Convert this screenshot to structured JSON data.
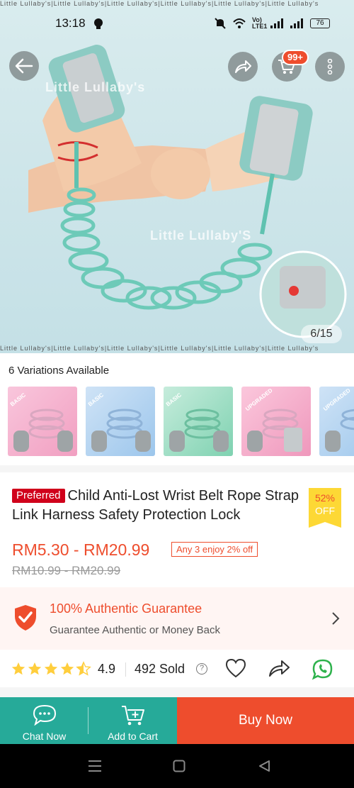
{
  "status_bar": {
    "time": "13:18",
    "network": "Vo) LTE1",
    "battery": "76"
  },
  "hero": {
    "watermark_1": "Little Lullaby's",
    "watermark_2": "Little Lullaby'S",
    "border_text": "Little Lullaby's|Little Lullaby's|Little Lullaby's|Little Lullaby's|Little Lullaby's|Little Lullaby's",
    "cart_badge": "99+",
    "pager": "6/15"
  },
  "variations": {
    "title": "6 Variations Available",
    "items": [
      {
        "tag": "BASIC",
        "color": "#f4a6c6"
      },
      {
        "tag": "BASIC",
        "color": "#a7cdee"
      },
      {
        "tag": "BASIC",
        "color": "#8fd6b8"
      },
      {
        "tag": "UPGRADED",
        "color": "#f3a7c4"
      },
      {
        "tag": "UPGRADED",
        "color": "#a7cdee"
      }
    ]
  },
  "product": {
    "badge": "Preferred",
    "title": "Child Anti-Lost Wrist Belt Rope Strap Link Harness Safety Protection Lock",
    "discount_pct": "52%",
    "discount_off": "OFF",
    "price": "RM5.30 - RM20.99",
    "promo": "Any 3 enjoy 2% off",
    "old_price": "RM10.99 - RM20.99"
  },
  "guarantee": {
    "title": "100% Authentic Guarantee",
    "subtitle": "Guarantee Authentic or Money Back"
  },
  "rating": {
    "value": "4.9",
    "stars": 4.5,
    "sold": "492 Sold",
    "help": "?"
  },
  "bottom_bar": {
    "chat_label": "Chat Now",
    "cart_label": "Add to Cart",
    "buy_label": "Buy Now"
  },
  "colors": {
    "accent": "#ee4d2d",
    "teal": "#26aa99",
    "star": "#ffce3d"
  }
}
